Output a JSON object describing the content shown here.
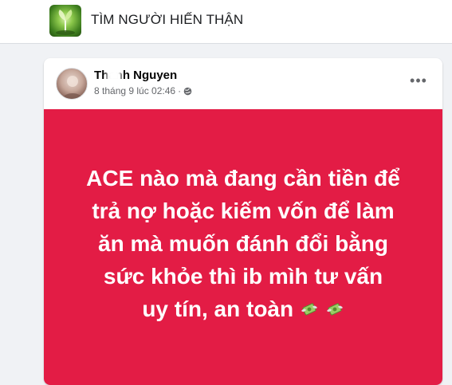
{
  "header": {
    "group_title": "TÌM NGƯỜI HIẾN THẬN",
    "group_icon": "group-photo-plant-icon"
  },
  "post": {
    "author": "Thanh Nguyen",
    "timestamp": "8 tháng 9 lúc 02:46",
    "meta_separator": "·",
    "privacy_icon": "globe-icon",
    "more_label": "•••",
    "background_color": "#e31c45",
    "text_lines": [
      "ACE nào mà đang cần tiền để",
      "trả nợ hoặc kiếm vốn để làm",
      "ăn mà muốn đánh đổi bằng",
      "sức khỏe thì ib mìh tư vấn",
      "uy tín, an toàn"
    ],
    "emoji": [
      "money-with-wings-icon",
      "money-with-wings-icon"
    ]
  }
}
